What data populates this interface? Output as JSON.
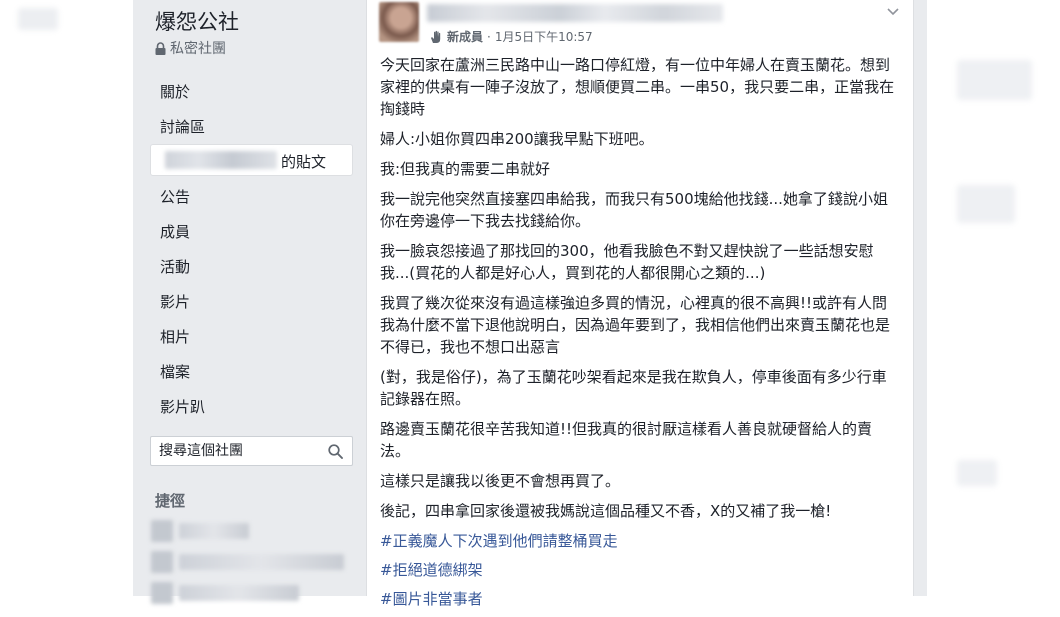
{
  "sidebar": {
    "group_name": "爆怨公社",
    "group_type": "私密社團",
    "nav": [
      {
        "label": "關於"
      },
      {
        "label": "討論區"
      },
      {
        "label": "的貼文"
      },
      {
        "label": "公告"
      },
      {
        "label": "成員"
      },
      {
        "label": "活動"
      },
      {
        "label": "影片"
      },
      {
        "label": "相片"
      },
      {
        "label": "檔案"
      },
      {
        "label": "影片趴"
      }
    ],
    "search_placeholder": "搜尋這個社團",
    "shortcuts_title": "捷徑"
  },
  "post": {
    "badge": "新成員",
    "timestamp": "1月5日下午10:57",
    "paragraphs": [
      "今天回家在蘆洲三民路中山一路口停紅燈，有一位中年婦人在賣玉蘭花。想到家裡的供桌有一陣子沒放了，想順便買二串。一串50，我只要二串，正當我在掏錢時",
      "婦人:小姐你買四串200讓我早點下班吧。",
      "我:但我真的需要二串就好",
      "我一說完他突然直接塞四串給我，而我只有500塊給他找錢...她拿了錢說小姐你在旁邊停一下我去找錢給你。",
      "我一臉哀怨接過了那找回的300，他看我臉色不對又趕快說了一些話想安慰我...(買花的人都是好心人，買到花的人都很開心之類的...)",
      "我買了幾次從來沒有過這樣強迫多買的情況，心裡真的很不高興!!或許有人問我為什麼不當下退他說明白，因為過年要到了，我相信他們出來賣玉蘭花也是不得已，我也不想口出惡言",
      "(對，我是俗仔)，為了玉蘭花吵架看起來是我在欺負人，停車後面有多少行車記錄器在照。",
      "路邊賣玉蘭花很辛苦我知道!!但我真的很討厭這樣看人善良就硬督給人的賣法。",
      "這樣只是讓我以後更不會想再買了。",
      "後記，四串拿回家後還被我媽說這個品種又不香，X的又補了我一槍!"
    ],
    "hashtags": [
      "#正義魔人下次遇到他們請整桶買走",
      "#拒絕道德綁架",
      "#圖片非當事者"
    ]
  },
  "icons": {
    "lock": "lock-icon",
    "search": "search-icon",
    "new_member": "wave-hand-icon",
    "options": "chevron-down-icon"
  },
  "colors": {
    "link": "#385898",
    "page_bg": "#e9ebee",
    "text": "#1d2129",
    "muted": "#606770"
  }
}
